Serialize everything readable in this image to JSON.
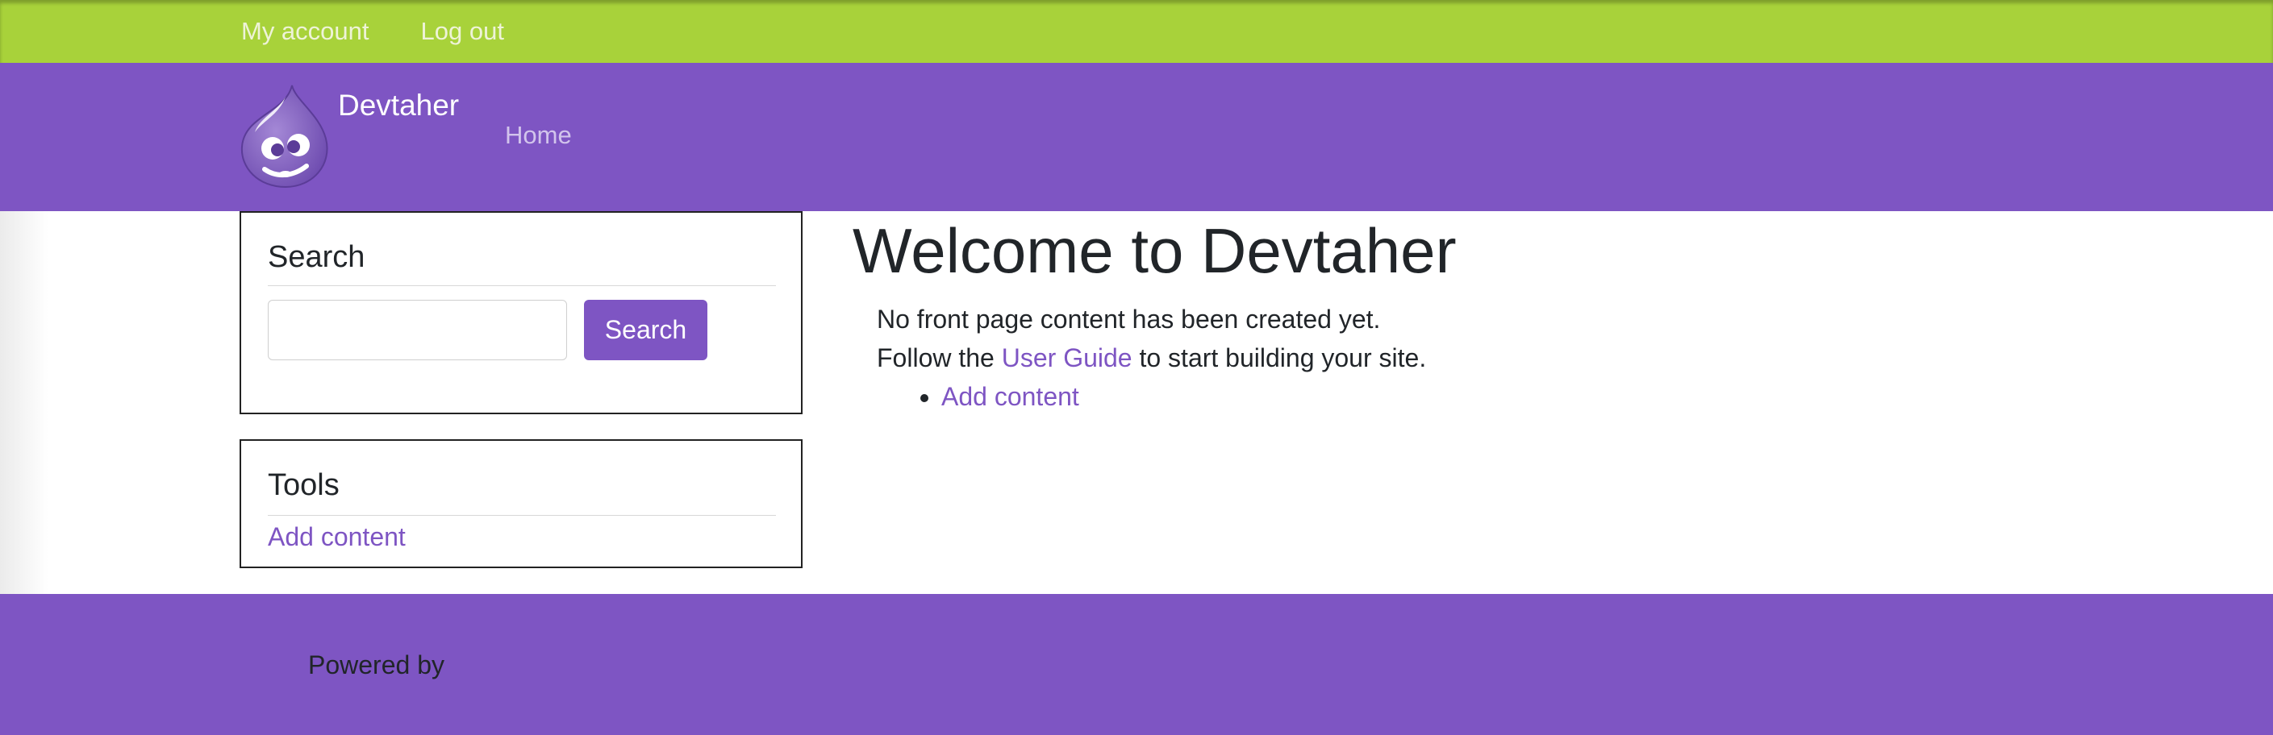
{
  "top_nav": {
    "items": [
      "My account",
      "Log out"
    ]
  },
  "header": {
    "logo_icon": "drupal-drop-icon",
    "site_name": "Devtaher",
    "main_nav": [
      "Home"
    ]
  },
  "sidebar": {
    "search_block": {
      "title": "Search",
      "input_value": "",
      "button_label": "Search"
    },
    "tools_block": {
      "title": "Tools",
      "link": "Add content"
    }
  },
  "main": {
    "title": "Welcome to Devtaher",
    "line1": "No front page content has been created yet.",
    "line2_prefix": "Follow the ",
    "line2_link": "User Guide",
    "line2_suffix": " to start building your site.",
    "list_items": [
      "Add content"
    ]
  },
  "footer": {
    "powered_by": "Powered by"
  },
  "colors": {
    "top_bar": "#a8d23a",
    "brand_purple": "#7e55c3",
    "text": "#212529",
    "link": "#7e55c3"
  }
}
